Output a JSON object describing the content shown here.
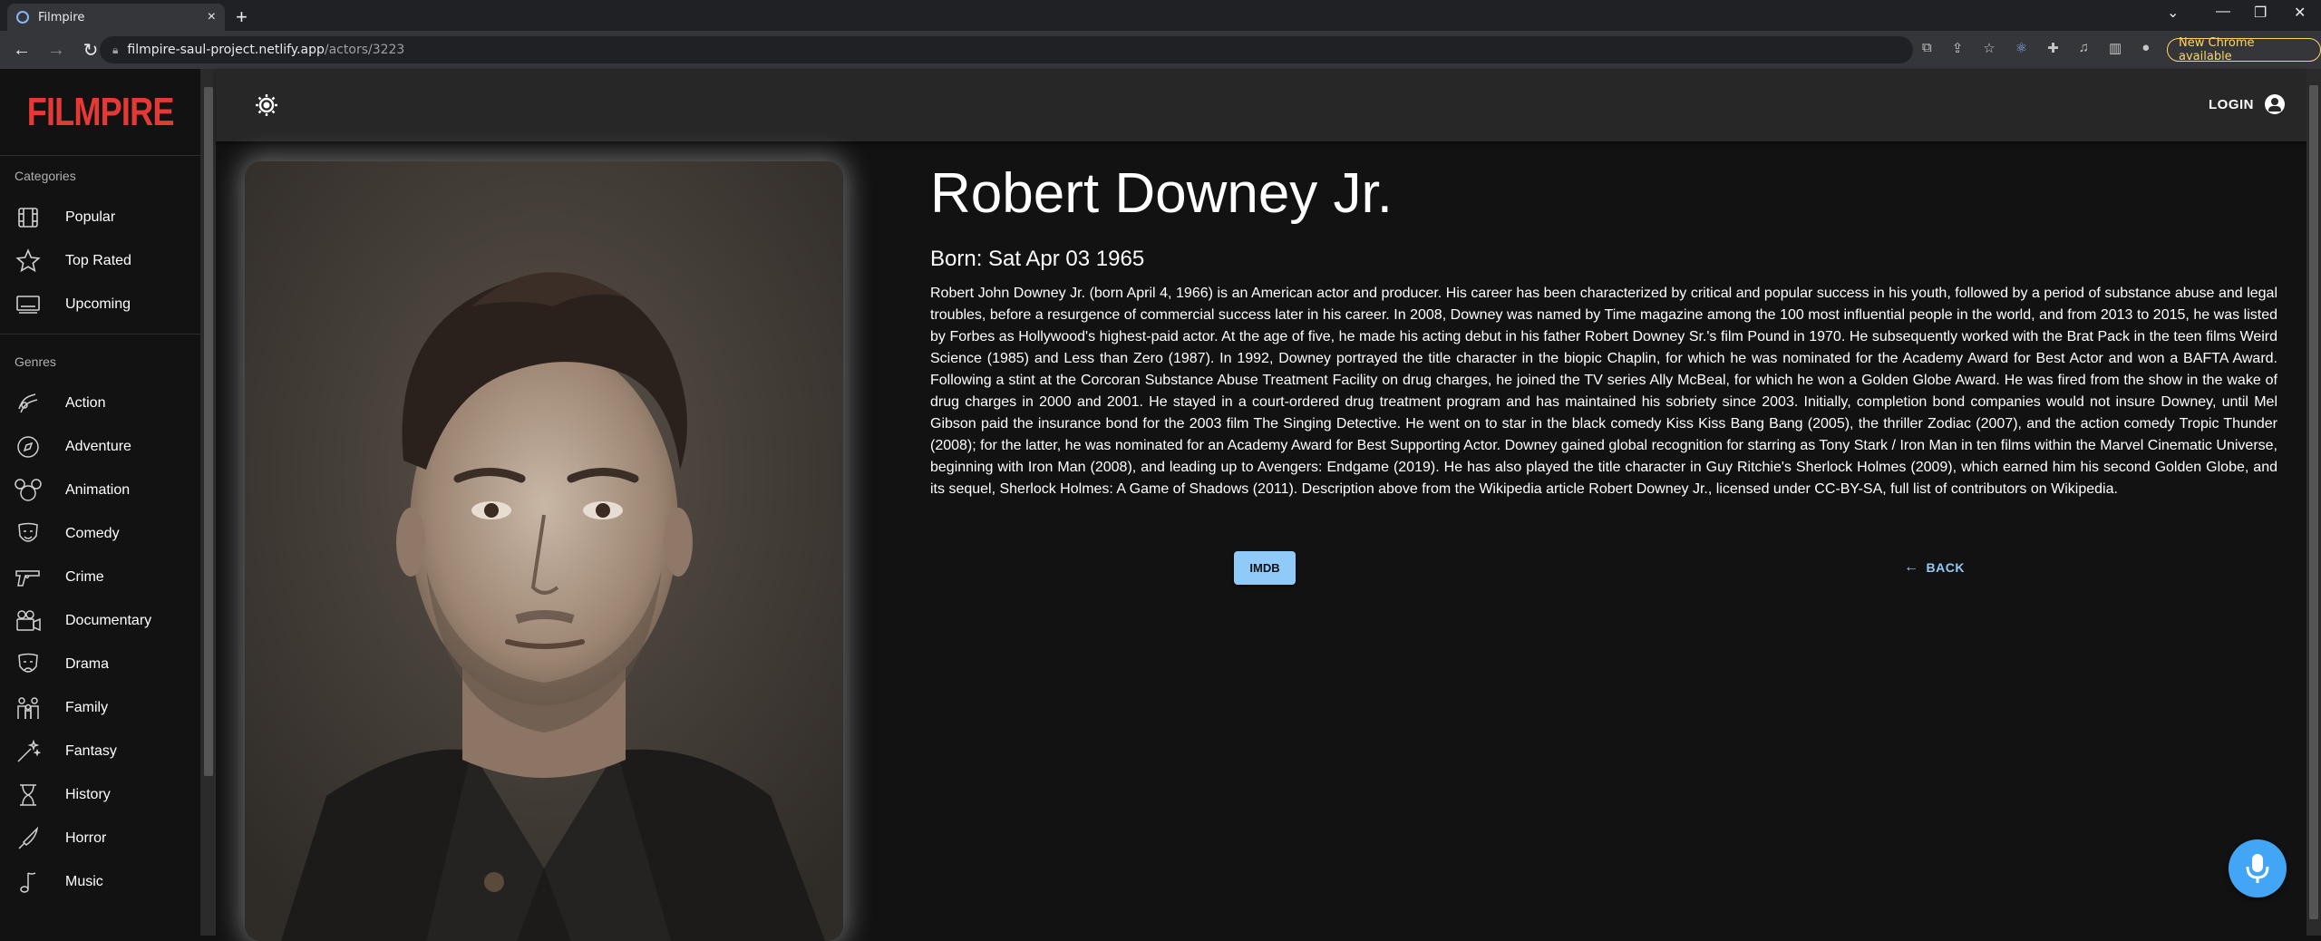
{
  "browser": {
    "tab_title": "Filmpire",
    "url_host": "filmpire-saul-project.netlify.app",
    "url_path": "/actors/3223",
    "update_label": "New Chrome available"
  },
  "sidebar": {
    "logo": "FILMPIRE",
    "categories_header": "Categories",
    "categories": [
      {
        "label": "Popular",
        "icon": "film-icon"
      },
      {
        "label": "Top Rated",
        "icon": "star-icon"
      },
      {
        "label": "Upcoming",
        "icon": "screen-icon"
      }
    ],
    "genres_header": "Genres",
    "genres": [
      {
        "label": "Action",
        "icon": "action-icon"
      },
      {
        "label": "Adventure",
        "icon": "compass-icon"
      },
      {
        "label": "Animation",
        "icon": "mouse-ears-icon"
      },
      {
        "label": "Comedy",
        "icon": "mask-icon"
      },
      {
        "label": "Crime",
        "icon": "gun-icon"
      },
      {
        "label": "Documentary",
        "icon": "camera-icon"
      },
      {
        "label": "Drama",
        "icon": "drama-icon"
      },
      {
        "label": "Family",
        "icon": "family-icon"
      },
      {
        "label": "Fantasy",
        "icon": "wand-icon"
      },
      {
        "label": "History",
        "icon": "hourglass-icon"
      },
      {
        "label": "Horror",
        "icon": "knife-icon"
      },
      {
        "label": "Music",
        "icon": "music-note-icon"
      }
    ]
  },
  "appbar": {
    "login_label": "LOGIN"
  },
  "actor": {
    "name": "Robert Downey Jr.",
    "born": "Born: Sat Apr 03 1965",
    "bio": "Robert John Downey Jr. (born April 4, 1966) is an American actor and producer. His career has been characterized by critical and popular success in his youth, followed by a period of substance abuse and legal troubles, before a resurgence of commercial success later in his career. In 2008, Downey was named by Time magazine among the 100 most influential people in the world, and from 2013 to 2015, he was listed by Forbes as Hollywood's highest-paid actor. At the age of five, he made his acting debut in his father Robert Downey Sr.'s film Pound in 1970. He subsequently worked with the Brat Pack in the teen films Weird Science (1985) and Less than Zero (1987). In 1992, Downey portrayed the title character in the biopic Chaplin, for which he was nominated for the Academy Award for Best Actor and won a BAFTA Award. Following a stint at the Corcoran Substance Abuse Treatment Facility on drug charges, he joined the TV series Ally McBeal, for which he won a Golden Globe Award. He was fired from the show in the wake of drug charges in 2000 and 2001. He stayed in a court-ordered drug treatment program and has maintained his sobriety since 2003. Initially, completion bond companies would not insure Downey, until Mel Gibson paid the insurance bond for the 2003 film The Singing Detective. He went on to star in the black comedy Kiss Kiss Bang Bang (2005), the thriller Zodiac (2007), and the action comedy Tropic Thunder (2008); for the latter, he was nominated for an Academy Award for Best Supporting Actor. Downey gained global recognition for starring as Tony Stark / Iron Man in ten films within the Marvel Cinematic Universe, beginning with Iron Man (2008), and leading up to Avengers: Endgame (2019). He has also played the title character in Guy Ritchie's Sherlock Holmes (2009), which earned him his second Golden Globe, and its sequel, Sherlock Holmes: A Game of Shadows (2011). Description above from the Wikipedia article Robert Downey Jr., licensed under CC-BY-SA, full list of contributors on Wikipedia.",
    "imdb_label": "IMDB",
    "back_label": "BACK"
  },
  "colors": {
    "brand": "#e53935",
    "accent": "#90caf9",
    "mic": "#42a5f5"
  }
}
